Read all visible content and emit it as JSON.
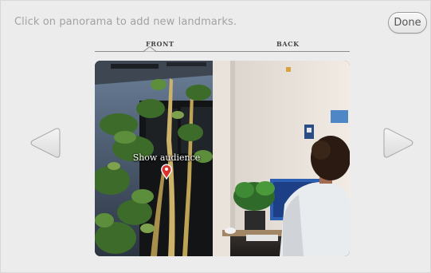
{
  "header": {
    "instruction": "Click on panorama to add new landmarks.",
    "done_label": "Done"
  },
  "tabs": [
    {
      "label": "FRONT",
      "selected": true
    },
    {
      "label": "BACK",
      "selected": false
    }
  ],
  "landmark": {
    "label": "Show audience",
    "pin_color": "#d9322e"
  },
  "icons": {
    "prev": "left-arrow-icon",
    "next": "right-arrow-icon",
    "pin": "map-pin-icon"
  }
}
